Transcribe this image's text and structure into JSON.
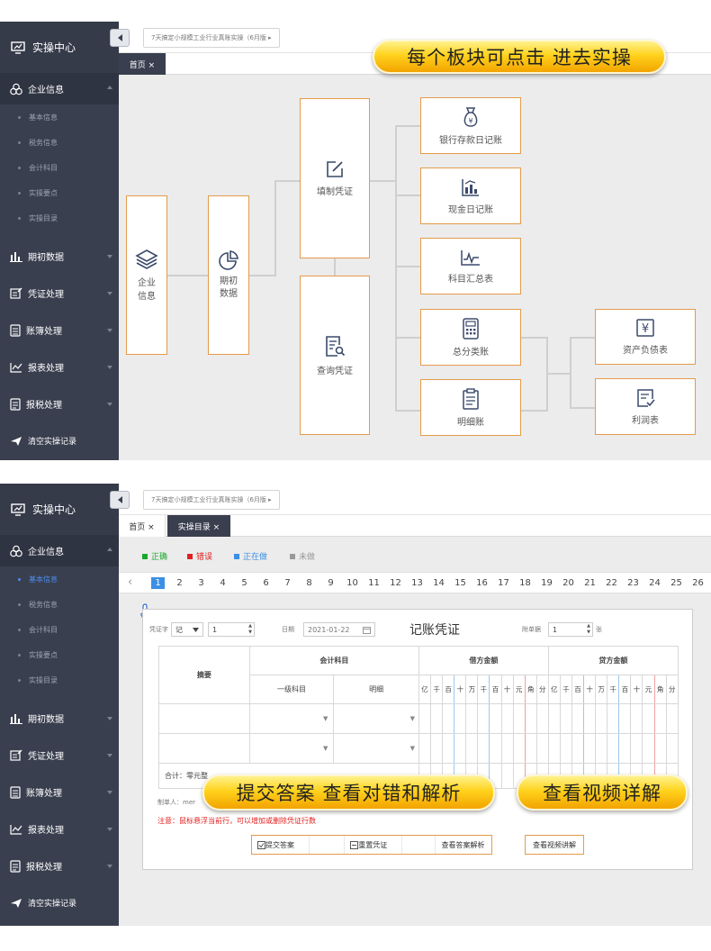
{
  "sidebar": {
    "title": "实操中心",
    "group": "企业信息",
    "sub_items": [
      "基本信息",
      "税务信息",
      "会计科目",
      "实操要点",
      "实操目录"
    ],
    "menus": [
      "期初数据",
      "凭证处理",
      "账簿处理",
      "报表处理",
      "报税处理",
      "清空实操记录"
    ]
  },
  "header": {
    "breadcrumb": "7天搞定小规模工业行业真账实操（6月版 ▸"
  },
  "top_panel": {
    "tabs": [
      "首页 ×"
    ],
    "banner": "每个板块可点击 进去实操",
    "modules": {
      "company_info": "企业\n信息",
      "opening_data": "期初\n数据",
      "fill_voucher": "填制凭证",
      "query_voucher": "查询凭证",
      "bank_journal": "银行存款日记账",
      "cash_journal": "现金日记账",
      "account_summary": "科目汇总表",
      "general_ledger": "总分类账",
      "detail_ledger": "明细账",
      "balance_sheet": "资产负债表",
      "income_statement": "利润表"
    }
  },
  "bottom_panel": {
    "tabs": [
      "首页 ×",
      "实操目录 ×"
    ],
    "legend": [
      {
        "label": "正确",
        "color": "#18a82c"
      },
      {
        "label": "错误",
        "color": "#e02020"
      },
      {
        "label": "正在做",
        "color": "#3b8fe4"
      },
      {
        "label": "未做",
        "color": "#999999"
      }
    ],
    "pagination": {
      "current": 1,
      "pages": [
        1,
        2,
        3,
        4,
        5,
        6,
        7,
        8,
        9,
        10,
        11,
        12,
        13,
        14,
        15,
        16,
        17,
        18,
        19,
        20,
        21,
        22,
        23,
        24,
        25,
        26
      ]
    },
    "voucher": {
      "word_label": "凭证字",
      "word_value": "记",
      "number_value": "1",
      "date_label": "日期",
      "date_value": "2021-01-22",
      "title": "记账凭证",
      "attach_label": "附单据",
      "attach_value": "1",
      "attach_unit": "张",
      "col_summary": "摘要",
      "col_account": "会计科目",
      "col_level1": "一级科目",
      "col_detail": "明细",
      "col_debit": "借方金额",
      "col_credit": "贷方金额",
      "digits": [
        "亿",
        "千",
        "百",
        "十",
        "万",
        "千",
        "百",
        "十",
        "元",
        "角",
        "分"
      ],
      "total": "合计：零元整",
      "maker": "制单人：mer",
      "note": "注意：鼠标悬浮当前行，可以增加或删除凭证行数"
    },
    "buttons": [
      "提交答案",
      "重置凭证",
      "查看答案解析",
      "查看视频讲解"
    ],
    "banner_left": "提交答案 查看对错和解析",
    "banner_right": "查看视频详解"
  }
}
